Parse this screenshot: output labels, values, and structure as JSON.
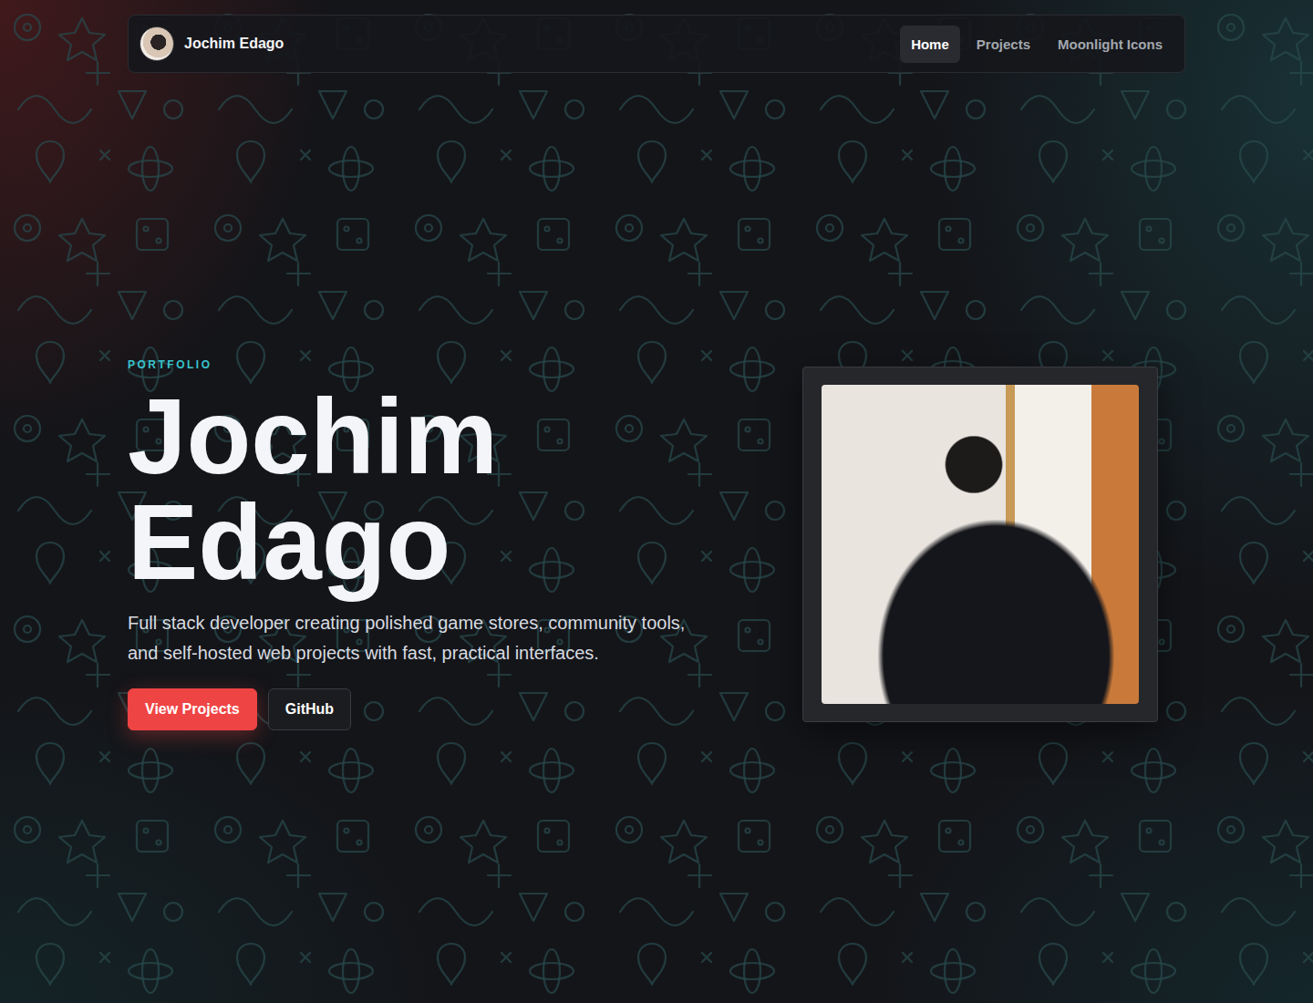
{
  "nav": {
    "brand": "Jochim Edago",
    "items": [
      {
        "label": "Home",
        "selected": true
      },
      {
        "label": "Projects",
        "selected": false
      },
      {
        "label": "Moonlight Icons",
        "selected": false
      }
    ]
  },
  "hero": {
    "eyebrow": "PORTFOLIO",
    "title": "Jochim Edago",
    "description": "Full stack developer creating polished game stores, community tools, and self-hosted web projects with fast, practical interfaces.",
    "buttons": [
      {
        "label": "View Projects",
        "kind": "primary"
      },
      {
        "label": "GitHub",
        "kind": "secondary"
      }
    ]
  }
}
